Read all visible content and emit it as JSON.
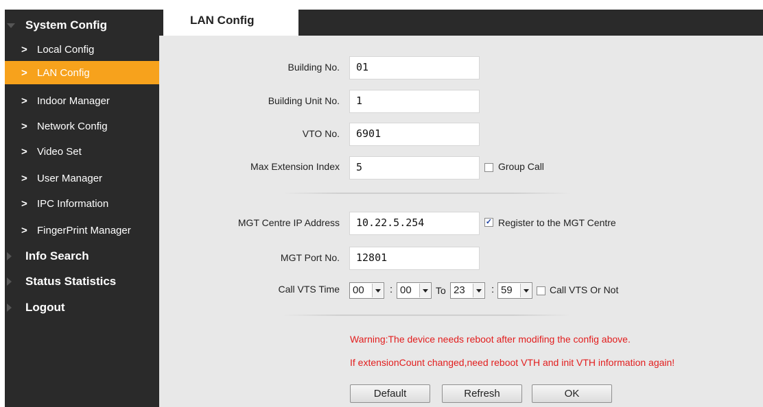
{
  "sidebar": {
    "groups": [
      {
        "label": "System Config",
        "expanded": true
      },
      {
        "label": "Info Search",
        "expanded": false
      },
      {
        "label": "Status Statistics",
        "expanded": false
      },
      {
        "label": "Logout",
        "expanded": false
      }
    ],
    "items": [
      {
        "label": "Local Config"
      },
      {
        "label": "LAN Config",
        "active": true
      },
      {
        "label": "Indoor Manager"
      },
      {
        "label": "Network Config"
      },
      {
        "label": "Video Set"
      },
      {
        "label": "User Manager"
      },
      {
        "label": "IPC Information"
      },
      {
        "label": "FingerPrint Manager"
      }
    ],
    "chevron": ">"
  },
  "tab": {
    "label": "LAN Config"
  },
  "form": {
    "building_no": {
      "label": "Building No.",
      "value": "01"
    },
    "building_unit_no": {
      "label": "Building Unit No.",
      "value": "1"
    },
    "vto_no": {
      "label": "VTO No.",
      "value": "6901"
    },
    "max_extension_index": {
      "label": "Max Extension Index",
      "value": "5"
    },
    "group_call": {
      "label": "Group Call",
      "checked": false
    },
    "mgt_ip": {
      "label": "MGT Centre IP Address",
      "value": "10.22.5.254"
    },
    "register_mgt": {
      "label": "Register to the MGT Centre",
      "checked": true
    },
    "mgt_port": {
      "label": "MGT Port No.",
      "value": "12801"
    },
    "call_vts_time": {
      "label": "Call VTS Time",
      "start_hour": "00",
      "start_min": "00",
      "to_label": "To",
      "end_hour": "23",
      "end_min": "59",
      "colon": ":"
    },
    "call_vts": {
      "label": "Call VTS Or Not",
      "checked": false
    }
  },
  "warnings": {
    "line1": "Warning:The device needs reboot after modifing the config above.",
    "line2": "If extensionCount changed,need reboot VTH and init VTH information again!"
  },
  "buttons": {
    "default": "Default",
    "refresh": "Refresh",
    "ok": "OK"
  },
  "colors": {
    "sidebar_bg": "#2a2a2a",
    "active_item": "#f7a21c",
    "content_bg": "#e8e8e8",
    "warning_text": "#e21d1d"
  },
  "icons": {
    "expanded_group": "triangle-down-icon",
    "collapsed_group": "triangle-right-icon",
    "menu_item": "chevron-right-icon",
    "select": "dropdown-arrow-icon",
    "checked_box": "checkmark-icon"
  }
}
